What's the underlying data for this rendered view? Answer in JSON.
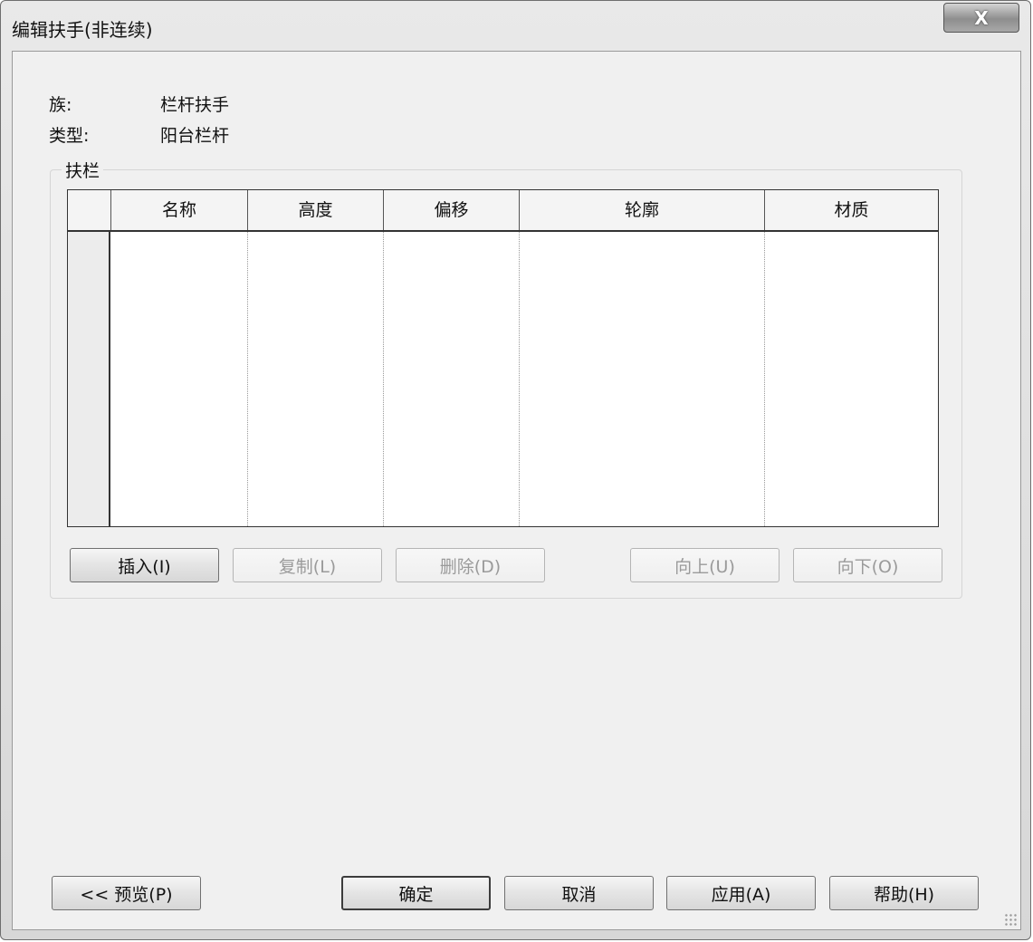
{
  "window": {
    "title": "编辑扶手(非连续)",
    "close_label": "X"
  },
  "info": {
    "family_label": "族:",
    "family_value": "栏杆扶手",
    "type_label": "类型:",
    "type_value": "阳台栏杆"
  },
  "group": {
    "legend": "扶栏"
  },
  "table": {
    "columns": [
      "名称",
      "高度",
      "偏移",
      "轮廓",
      "材质"
    ],
    "rows": []
  },
  "row_buttons": {
    "insert": "插入(I)",
    "copy": "复制(L)",
    "delete": "删除(D)",
    "up": "向上(U)",
    "down": "向下(O)"
  },
  "footer_buttons": {
    "preview": "<< 预览(P)",
    "ok": "确定",
    "cancel": "取消",
    "apply": "应用(A)",
    "help": "帮助(H)"
  }
}
